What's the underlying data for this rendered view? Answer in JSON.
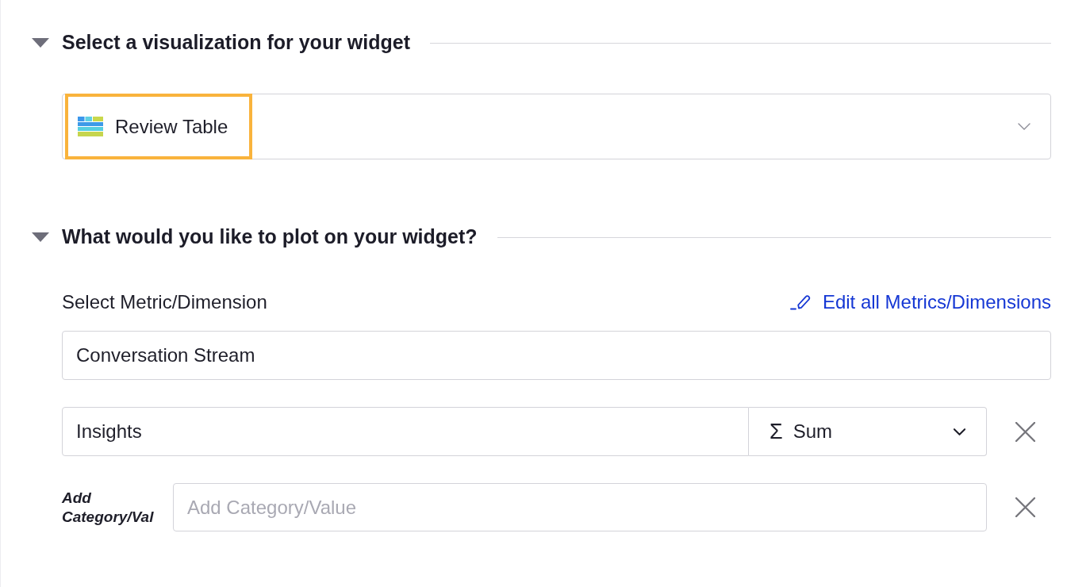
{
  "sections": [
    {
      "kind": "visualization",
      "title": "Select a visualization for your widget",
      "expanded": true,
      "select": {
        "value": "Review Table",
        "highlighted": true
      }
    },
    {
      "kind": "plot",
      "title": "What would you like to plot on your widget?",
      "expanded": true,
      "field_label": "Select Metric/Dimension",
      "edit_link": "Edit all Metrics/Dimensions",
      "metric_field": {
        "value": "Conversation Stream"
      },
      "measure_row": {
        "value": "Insights",
        "aggregation": {
          "symbol": "Σ",
          "label": "Sum"
        }
      },
      "category_row": {
        "label": "Add Category/Val",
        "placeholder": "Add Category/Value"
      }
    }
  ]
}
